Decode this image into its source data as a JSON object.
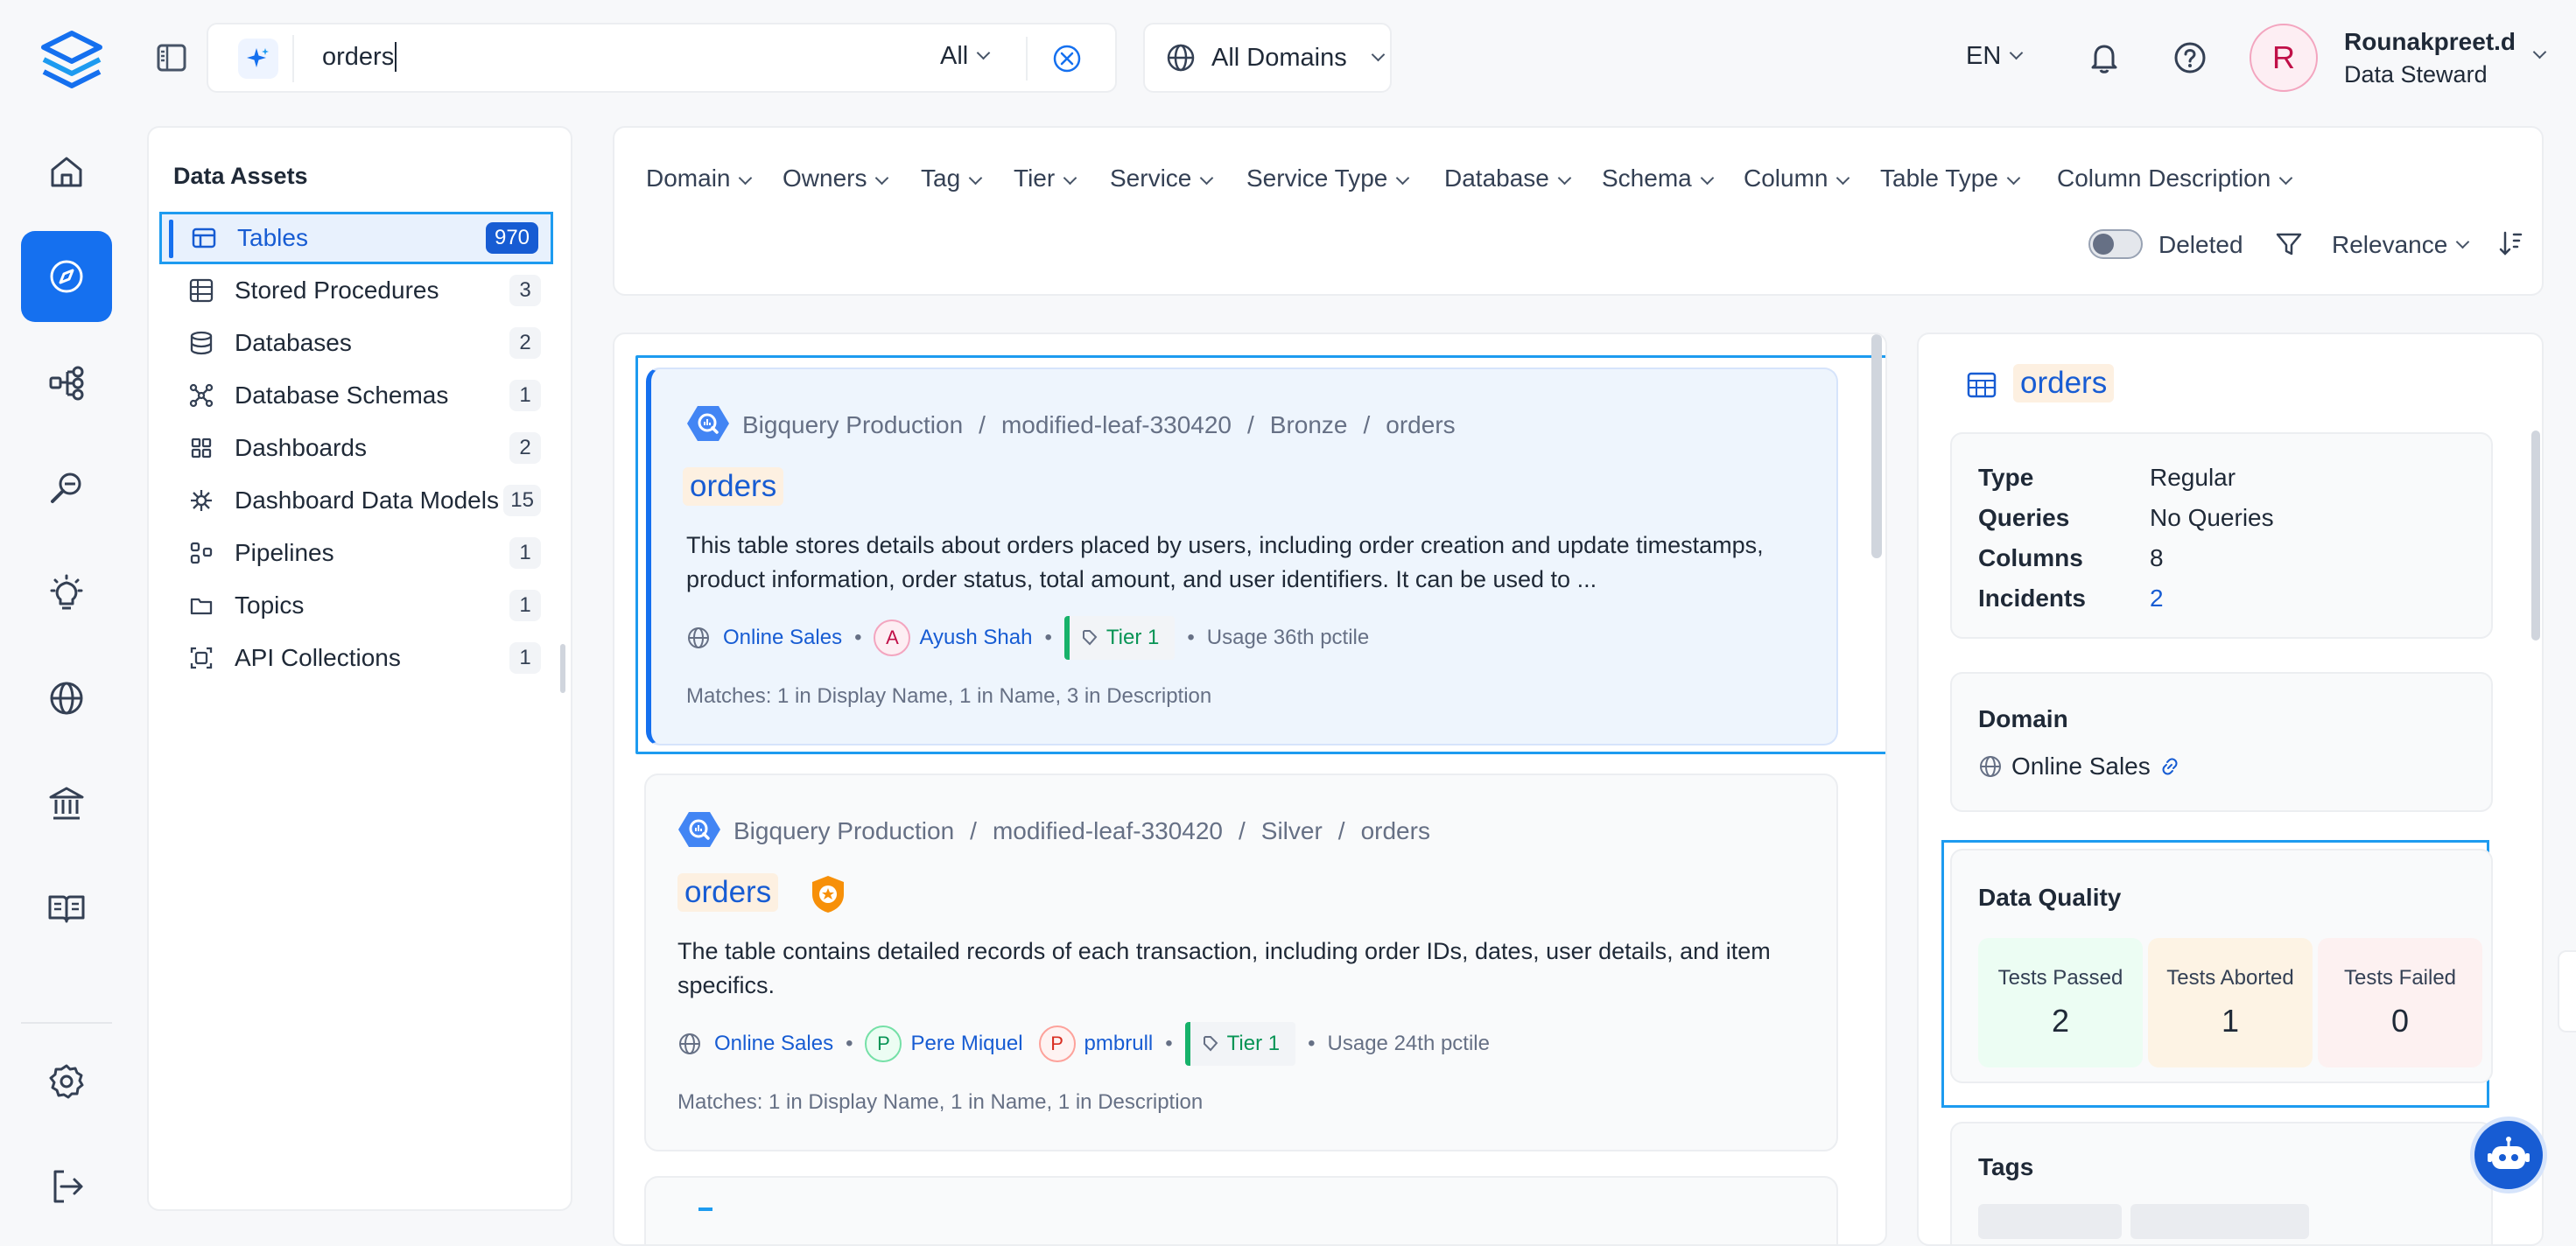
{
  "search": {
    "query": "orders",
    "scope": "All",
    "domain": "All Domains"
  },
  "header": {
    "language": "EN",
    "user": {
      "initial": "R",
      "name": "Rounakpreet.d",
      "role": "Data Steward"
    }
  },
  "nav": {
    "icons": [
      "home-icon",
      "explore-icon",
      "lineage-icon",
      "observability-icon",
      "insights-icon",
      "domains-icon",
      "governance-icon",
      "glossary-icon",
      "settings-icon",
      "logout-icon"
    ],
    "active": "explore-icon"
  },
  "assets": {
    "title": "Data Assets",
    "items": [
      {
        "label": "Tables",
        "count": "970",
        "icon": "table-icon",
        "active": true
      },
      {
        "label": "Stored Procedures",
        "count": "3",
        "icon": "stored-procedure-icon"
      },
      {
        "label": "Databases",
        "count": "2",
        "icon": "database-icon"
      },
      {
        "label": "Database Schemas",
        "count": "1",
        "icon": "schema-icon"
      },
      {
        "label": "Dashboards",
        "count": "2",
        "icon": "dashboard-icon"
      },
      {
        "label": "Dashboard Data Models",
        "count": "15",
        "icon": "data-model-icon"
      },
      {
        "label": "Pipelines",
        "count": "1",
        "icon": "pipeline-icon"
      },
      {
        "label": "Topics",
        "count": "1",
        "icon": "topic-icon"
      },
      {
        "label": "API Collections",
        "count": "1",
        "icon": "api-collection-icon"
      }
    ]
  },
  "filters": {
    "items": [
      "Domain",
      "Owners",
      "Tag",
      "Tier",
      "Service",
      "Service Type",
      "Database",
      "Schema",
      "Column",
      "Table Type",
      "Column Description"
    ],
    "deleted_label": "Deleted",
    "sort_label": "Relevance"
  },
  "results": [
    {
      "crumbs": [
        "Bigquery Production",
        "modified-leaf-330420",
        "Bronze",
        "orders"
      ],
      "title": "orders",
      "description": "This table stores details about orders placed by users, including order creation and update timestamps, product information, order status, total amount, and user identifiers. It can be used to ...",
      "domain": "Online Sales",
      "owners": [
        {
          "initial": "A",
          "name": "Ayush Shah"
        }
      ],
      "tier": "Tier 1",
      "usage": "Usage 36th pctile",
      "matches": "Matches:  1 in Display Name,  1 in Name,  3 in Description"
    },
    {
      "crumbs": [
        "Bigquery Production",
        "modified-leaf-330420",
        "Silver",
        "orders"
      ],
      "title": "orders",
      "description": "The table contains detailed records of each transaction, including order IDs, dates, user details, and item specifics.",
      "domain": "Online Sales",
      "owners": [
        {
          "initial": "P",
          "name": "Pere Miquel"
        },
        {
          "initial": "P",
          "name": "pmbrull"
        }
      ],
      "tier": "Tier 1",
      "usage": "Usage 24th pctile",
      "matches": "Matches:  1 in Display Name,  1 in Name,  1 in Description"
    }
  ],
  "detail": {
    "title": "orders",
    "summary": [
      {
        "key": "Type",
        "value": "Regular"
      },
      {
        "key": "Queries",
        "value": "No Queries"
      },
      {
        "key": "Columns",
        "value": "8"
      },
      {
        "key": "Incidents",
        "value": "2"
      }
    ],
    "domain_label": "Domain",
    "domain_value": "Online Sales",
    "data_quality": {
      "title": "Data Quality",
      "passed_label": "Tests Passed",
      "passed": "2",
      "aborted_label": "Tests Aborted",
      "aborted": "1",
      "failed_label": "Tests Failed",
      "failed": "0"
    },
    "tags_label": "Tags"
  },
  "colors": {
    "accent": "#1570ef",
    "link": "#175cd3",
    "tier": "#17b26a",
    "highlight_border": "#1d9bf0"
  }
}
